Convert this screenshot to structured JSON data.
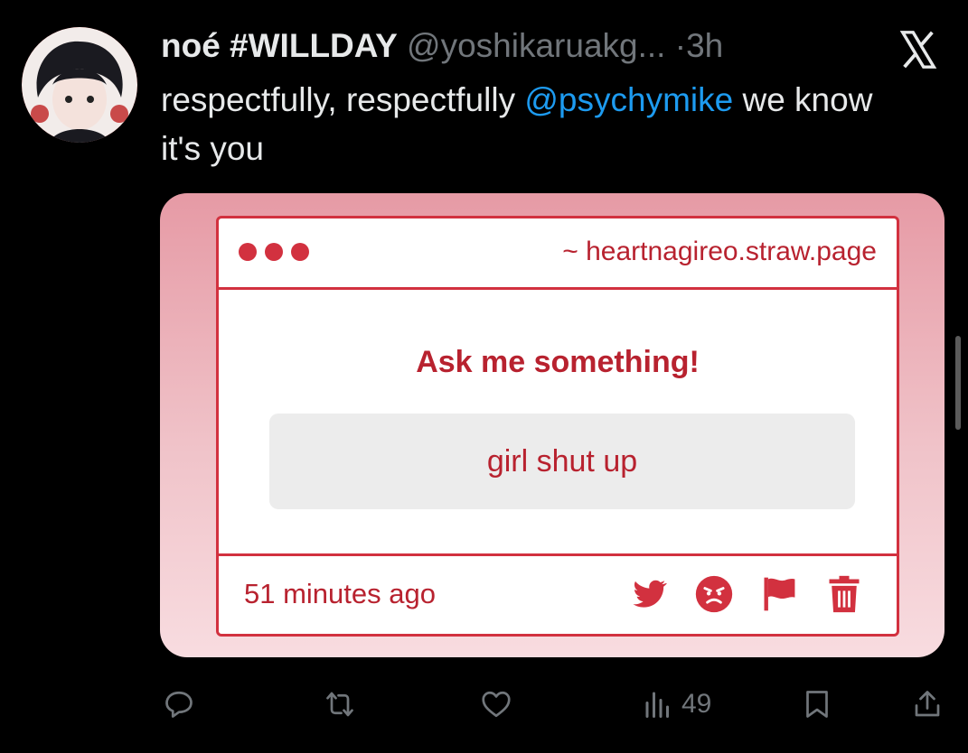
{
  "tweet": {
    "author_name": "noé #WILLDAY",
    "handle": "@yoshikaruakg...",
    "separator": "·",
    "time": "3h",
    "text_before": "respectfully, respectfully ",
    "mention": "@psychymike",
    "text_after": " we know it's you",
    "views": "49"
  },
  "card": {
    "url": "~ heartnagireo.straw.page",
    "prompt": "Ask me something!",
    "answer": "girl shut up",
    "time_ago": "51 minutes ago"
  },
  "icons": {
    "platform": "x-logo-icon",
    "footer": [
      "twitter-bird-icon",
      "angry-face-icon",
      "flag-icon",
      "trash-icon"
    ],
    "actions": [
      "reply-icon",
      "retweet-icon",
      "like-icon",
      "views-icon",
      "bookmark-icon",
      "share-icon"
    ]
  },
  "colors": {
    "background": "#000000",
    "text": "#e7e9ea",
    "muted": "#71767b",
    "mention": "#1d9bf0",
    "accent_red": "#d2313f",
    "card_pink": "#e69aa5"
  }
}
